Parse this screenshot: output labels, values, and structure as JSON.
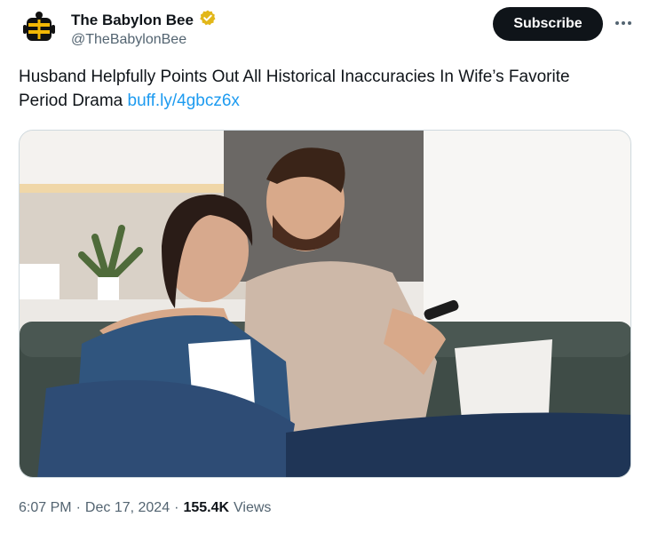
{
  "tweet": {
    "author": {
      "display_name": "The Babylon Bee",
      "handle": "@TheBabylonBee",
      "verified_badge": "verified-gold-badge"
    },
    "subscribe_label": "Subscribe",
    "more_icon": "more-horizontal-icon",
    "text": "Husband Helpfully Points Out All Historical Inaccuracies In Wife’s Favorite Period Drama",
    "link": "buff.ly/4gbcz6x",
    "time": "6:07 PM",
    "separator": "·",
    "date": "Dec 17, 2024",
    "views_count": "155.4K",
    "views_label": "Views"
  },
  "colors": {
    "link": "#1d9bf0",
    "subscribe_bg": "#0f1419",
    "badge": "#e2b719",
    "muted": "#536471"
  }
}
